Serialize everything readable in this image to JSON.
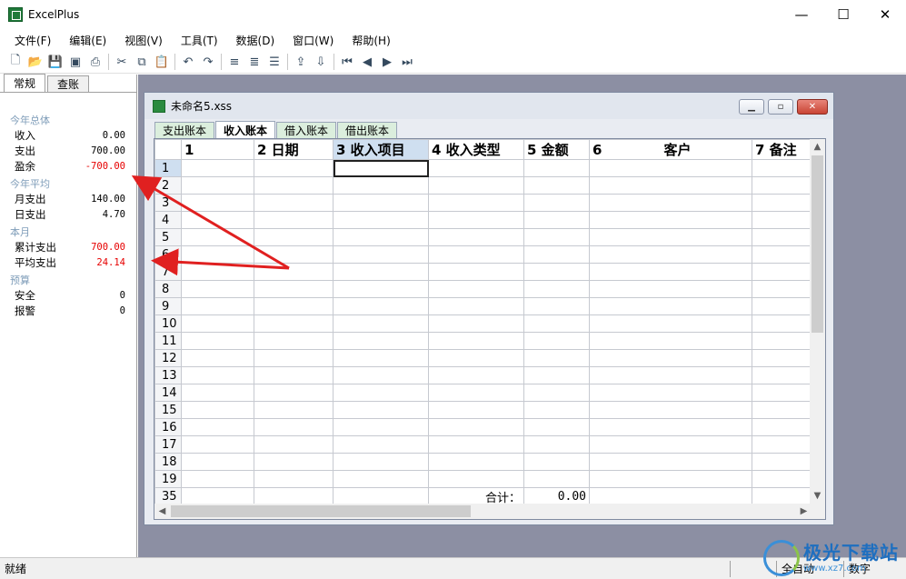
{
  "window": {
    "title": "ExcelPlus",
    "minimize": "—",
    "maximize": "☐",
    "close": "✕"
  },
  "menu": [
    "文件(F)",
    "编辑(E)",
    "视图(V)",
    "工具(T)",
    "数据(D)",
    "窗口(W)",
    "帮助(H)"
  ],
  "toolbar_icons": [
    "new-icon",
    "open-icon",
    "save-icon",
    "save-all-icon",
    "print-icon",
    "cut-icon",
    "copy-icon",
    "paste-icon",
    "undo-icon",
    "redo-icon",
    "align-left-icon",
    "align-center-icon",
    "align-right-icon",
    "export-icon",
    "import-icon",
    "first-icon",
    "prev-icon",
    "next-icon",
    "last-icon"
  ],
  "left_panel": {
    "tabs": [
      "常规",
      "查账"
    ],
    "groups": [
      {
        "title": "今年总体",
        "rows": [
          {
            "label": "收入",
            "value": "0.00",
            "red": false
          },
          {
            "label": "支出",
            "value": "700.00",
            "red": false
          },
          {
            "label": "盈余",
            "value": "-700.00",
            "red": true
          }
        ]
      },
      {
        "title": "今年平均",
        "rows": [
          {
            "label": "月支出",
            "value": "140.00",
            "red": false
          },
          {
            "label": "日支出",
            "value": "4.70",
            "red": false
          }
        ]
      },
      {
        "title": "本月",
        "rows": [
          {
            "label": "累计支出",
            "value": "700.00",
            "red": true
          },
          {
            "label": "平均支出",
            "value": "24.14",
            "red": true
          }
        ]
      },
      {
        "title": "预算",
        "rows": [
          {
            "label": "安全",
            "value": "0",
            "red": false
          },
          {
            "label": "报警",
            "value": "0",
            "red": false
          }
        ]
      }
    ]
  },
  "document": {
    "title": "未命名5.xss",
    "sheet_tabs": [
      "支出账本",
      "收入账本",
      "借入账本",
      "借出账本"
    ],
    "active_sheet": 1,
    "columns": [
      "1",
      "2 日期",
      "3 收入项目",
      "4 收入类型",
      "5 金额",
      "6",
      "客户",
      "7 备注"
    ],
    "row_numbers": [
      "1",
      "2",
      "3",
      "4",
      "5",
      "6",
      "7",
      "8",
      "9",
      "10",
      "11",
      "12",
      "13",
      "14",
      "15",
      "16",
      "17",
      "18",
      "19"
    ],
    "total_row_number": "35",
    "total_label": "合计：",
    "total_value": "0.00"
  },
  "status": {
    "left": "就绪",
    "pane1": "全自动",
    "pane2": "数字"
  },
  "watermark": {
    "main": "极光下载站",
    "sub": "www.xz7.com"
  },
  "colors": {
    "accent_red": "#e60000",
    "mdi_background": "#8c8fa3",
    "annotation_arrow": "#e02020"
  }
}
